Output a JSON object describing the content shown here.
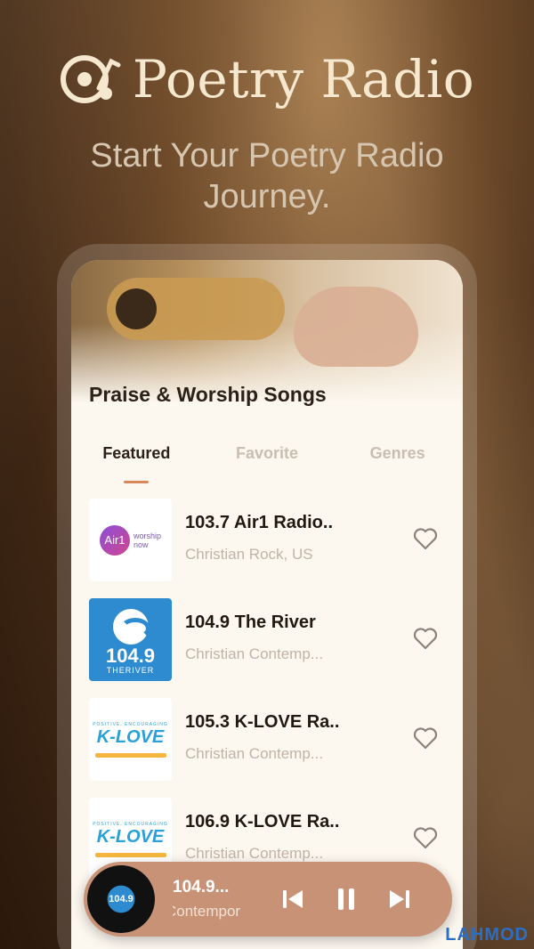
{
  "header": {
    "app_title": "Poetry Radio",
    "tagline_line1": "Start Your Poetry Radio",
    "tagline_line2": "Journey."
  },
  "banner": {
    "title": "Praise & Worship Songs"
  },
  "tabs": [
    {
      "label": "Featured",
      "active": true
    },
    {
      "label": "Favorite",
      "active": false
    },
    {
      "label": "Genres",
      "active": false
    }
  ],
  "stations": [
    {
      "title": "103.7 Air1 Radio..",
      "subtitle": "Christian Rock, US",
      "logo_text": "Air1",
      "logo_sub1": "worship",
      "logo_sub2": "now"
    },
    {
      "title": "104.9 The River",
      "subtitle": "Christian Contemp...",
      "logo_text": "104.9",
      "logo_sub1": "THERIVER"
    },
    {
      "title": "105.3 K-LOVE Ra..",
      "subtitle": "Christian Contemp...",
      "logo_text": "K-LOVE",
      "logo_sub1": "POSITIVE, ENCOURAGING"
    },
    {
      "title": "106.9 K-LOVE Ra..",
      "subtitle": "Christian Contemp...",
      "logo_text": "K-LOVE",
      "logo_sub1": "POSITIVE, ENCOURAGING"
    }
  ],
  "player": {
    "title": "104.9...",
    "subtitle": "Contempor",
    "disc_label": "104.9"
  },
  "watermark": "LAHMOD",
  "colors": {
    "accent": "#d8875a",
    "player_bg": "#c89276",
    "title_cream": "#f6e7cf"
  }
}
